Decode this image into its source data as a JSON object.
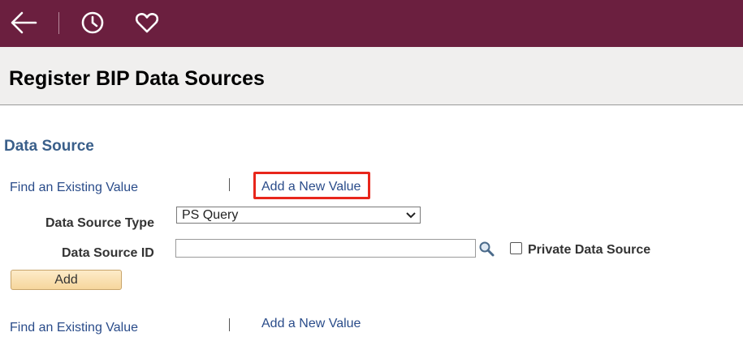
{
  "header": {
    "back_icon": "arrow-left-icon",
    "history_icon": "clock-icon",
    "favorites_icon": "heart-icon"
  },
  "page": {
    "title": "Register BIP Data Sources"
  },
  "section": {
    "title": "Data Source"
  },
  "top_links": {
    "find_existing": "Find an Existing Value",
    "add_new": "Add a New Value"
  },
  "form": {
    "data_source_type_label": "Data Source Type",
    "data_source_type_value": "PS Query",
    "data_source_id_label": "Data Source ID",
    "data_source_id_value": "",
    "private_label": "Private Data Source",
    "private_checked": false,
    "add_button": "Add"
  },
  "bottom_links": {
    "find_existing": "Find an Existing Value",
    "add_new": "Add a New Value"
  },
  "colors": {
    "banner": "#6b1f3f",
    "link": "#2a4c8a",
    "section_title": "#3a5f8a",
    "highlight": "#e8261b"
  }
}
